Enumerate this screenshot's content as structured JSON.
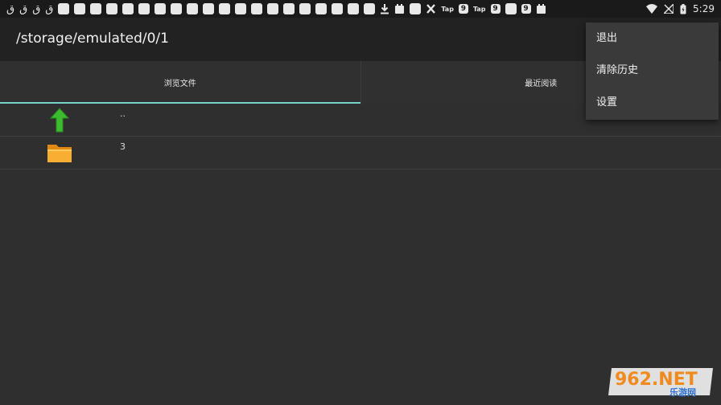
{
  "status_bar": {
    "left_glyphs": [
      "ق",
      "ق",
      "ق",
      "ق"
    ],
    "tap_label": "Tap",
    "ring_label": "9",
    "time": "5:29"
  },
  "toolbar": {
    "path": "/storage/emulated/0/1"
  },
  "tabs": [
    {
      "label": "浏览文件",
      "active": true
    },
    {
      "label": "最近阅读",
      "active": false
    }
  ],
  "files": [
    {
      "name": "..",
      "icon": "up-arrow-icon"
    },
    {
      "name": "3",
      "icon": "folder-icon"
    }
  ],
  "menu": {
    "items": [
      "退出",
      "清除历史",
      "设置"
    ]
  },
  "watermark": {
    "brand": "962.NET",
    "sub": "乐游网"
  },
  "colors": {
    "accent": "#7ad3c8",
    "background": "#2f2f2f",
    "toolbar": "#222222",
    "menu": "#3a3a3a"
  }
}
